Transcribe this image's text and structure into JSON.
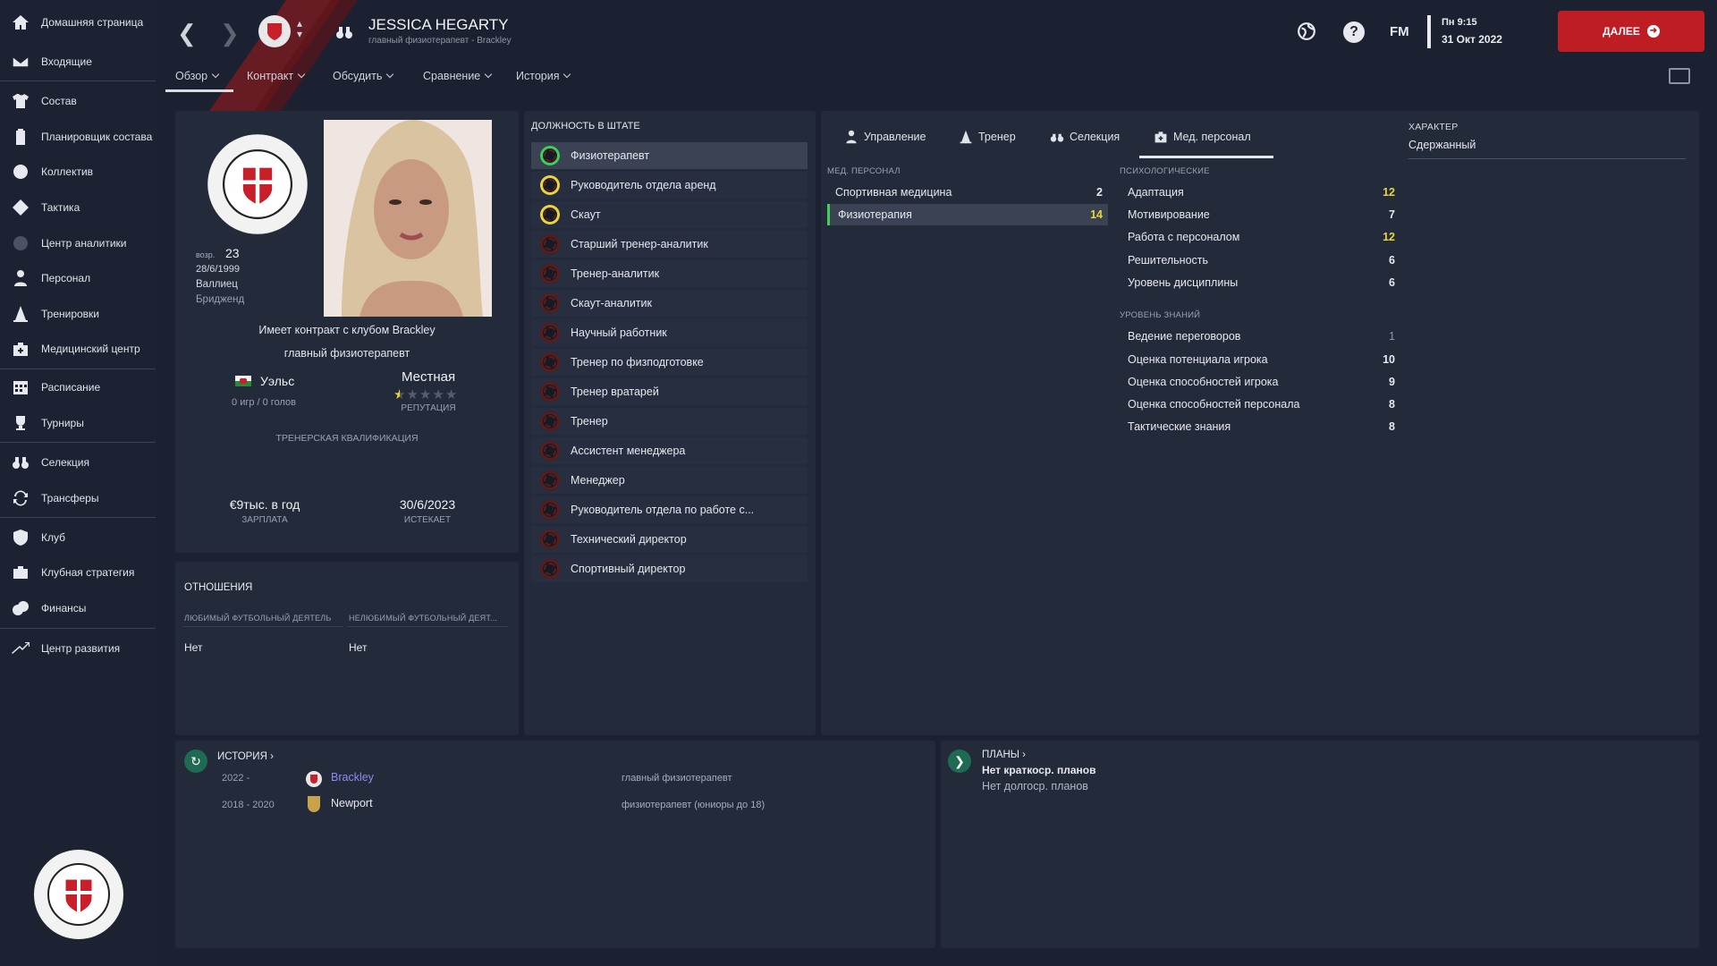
{
  "sidebar": {
    "items": [
      {
        "label": "Домашняя страница",
        "icon": "home-icon"
      },
      {
        "label": "Входящие",
        "icon": "mail-icon"
      },
      {
        "label": "Состав",
        "icon": "shirt-icon"
      },
      {
        "label": "Планировщик состава",
        "icon": "clipboard-icon"
      },
      {
        "label": "Коллектив",
        "icon": "group-icon"
      },
      {
        "label": "Тактика",
        "icon": "tactics-icon"
      },
      {
        "label": "Центр аналитики",
        "icon": "analytics-icon"
      },
      {
        "label": "Персонал",
        "icon": "staff-icon"
      },
      {
        "label": "Тренировки",
        "icon": "cone-icon"
      },
      {
        "label": "Медицинский центр",
        "icon": "medical-icon"
      },
      {
        "label": "Расписание",
        "icon": "calendar-icon"
      },
      {
        "label": "Турниры",
        "icon": "trophy-icon"
      },
      {
        "label": "Селекция",
        "icon": "binoculars-icon"
      },
      {
        "label": "Трансферы",
        "icon": "transfer-icon"
      },
      {
        "label": "Клуб",
        "icon": "shield-icon"
      },
      {
        "label": "Клубная стратегия",
        "icon": "briefcase-icon"
      },
      {
        "label": "Финансы",
        "icon": "money-icon"
      },
      {
        "label": "Центр развития",
        "icon": "development-icon"
      }
    ]
  },
  "header": {
    "name": "JESSICA HEGARTY",
    "subtitle": "главный физиотерапевт - Brackley",
    "tabs": [
      "Обзор",
      "Контракт",
      "Обсудить",
      "Сравнение",
      "История"
    ],
    "fm_label": "FM",
    "date_line1": "Пн 9:15",
    "date_line2": "31 Окт 2022",
    "continue_label": "ДАЛЕЕ"
  },
  "profile": {
    "club_logo_text": "BRACKLEY TOWN FOOTBALL CLUB",
    "age_label": "возр.",
    "age": "23",
    "dob": "28/6/1999",
    "nationality": "Валлиец",
    "birthplace": "Бридженд",
    "contract_line": "Имеет контракт с клубом Brackley",
    "role": "главный физиотерапевт",
    "country": "Уэльс",
    "caps": "0 игр / 0 голов",
    "reputation_word": "Местная",
    "reputation_label": "РЕПУТАЦИЯ",
    "reputation_stars": 0.5,
    "coaching_qual_label": "ТРЕНЕРСКАЯ КВАЛИФИКАЦИЯ",
    "salary": "€9тыс. в год",
    "salary_label": "ЗАРПЛАТА",
    "expires": "30/6/2023",
    "expires_label": "ИСТЕКАЕТ"
  },
  "relations": {
    "title": "ОТНОШЕНИЯ",
    "fav_label": "ЛЮБИМЫЙ ФУТБОЛЬНЫЙ ДЕЯТЕЛЬ",
    "fav_value": "Нет",
    "disliked_label": "НЕЛЮБИМЫЙ ФУТБОЛЬНЫЙ ДЕЯТ...",
    "disliked_value": "Нет"
  },
  "positions": {
    "title": "ДОЛЖНОСТЬ В ШТАТЕ",
    "items": [
      {
        "label": "Физиотерапевт",
        "rating": "green"
      },
      {
        "label": "Руководитель отдела аренд",
        "rating": "yellow"
      },
      {
        "label": "Скаут",
        "rating": "yellow"
      },
      {
        "label": "Старший тренер-аналитик",
        "rating": "red"
      },
      {
        "label": "Тренер-аналитик",
        "rating": "red"
      },
      {
        "label": "Скаут-аналитик",
        "rating": "red"
      },
      {
        "label": "Научный работник",
        "rating": "red"
      },
      {
        "label": "Тренер по физподготовке",
        "rating": "red"
      },
      {
        "label": "Тренер вратарей",
        "rating": "red"
      },
      {
        "label": "Тренер",
        "rating": "red"
      },
      {
        "label": "Ассистент менеджера",
        "rating": "red"
      },
      {
        "label": "Менеджер",
        "rating": "red"
      },
      {
        "label": "Руководитель отдела по работе с...",
        "rating": "red"
      },
      {
        "label": "Технический директор",
        "rating": "red"
      },
      {
        "label": "Спортивный директор",
        "rating": "red"
      }
    ]
  },
  "attr_tabs": [
    "Управление",
    "Тренер",
    "Селекция",
    "Мед. персонал"
  ],
  "med_staff": {
    "title": "МЕД. ПЕРСОНАЛ",
    "rows": [
      {
        "label": "Спортивная медицина",
        "value": "2"
      },
      {
        "label": "Физиотерапия",
        "value": "14"
      }
    ]
  },
  "mental": {
    "title": "ПСИХОЛОГИЧЕСКИЕ",
    "rows": [
      {
        "label": "Адаптация",
        "value": "12"
      },
      {
        "label": "Мотивирование",
        "value": "7"
      },
      {
        "label": "Работа с персоналом",
        "value": "12"
      },
      {
        "label": "Решительность",
        "value": "6"
      },
      {
        "label": "Уровень дисциплины",
        "value": "6"
      }
    ]
  },
  "knowledge": {
    "title": "УРОВЕНЬ ЗНАНИЙ",
    "rows": [
      {
        "label": "Ведение переговоров",
        "value": "1"
      },
      {
        "label": "Оценка потенциала игрока",
        "value": "10"
      },
      {
        "label": "Оценка способностей игрока",
        "value": "9"
      },
      {
        "label": "Оценка способностей персонала",
        "value": "8"
      },
      {
        "label": "Тактические знания",
        "value": "8"
      }
    ]
  },
  "personality": {
    "title": "ХАРАКТЕР",
    "value": "Сдержанный"
  },
  "history": {
    "title": "ИСТОРИЯ",
    "rows": [
      {
        "years": "2022 -",
        "club": "Brackley",
        "role": "главный физиотерапевт"
      },
      {
        "years": "2018 - 2020",
        "club": "Newport",
        "role": "физиотерапевт (юниоры до 18)"
      }
    ]
  },
  "plans": {
    "title": "ПЛАНЫ",
    "short": "Нет краткоср. планов",
    "long": "Нет долгоср. планов"
  },
  "colors": {
    "accent_red": "#bf1d24",
    "highlight_yellow": "#e9d63c",
    "good_green": "#3fcf5a",
    "history_link": "#8f8cf0"
  }
}
